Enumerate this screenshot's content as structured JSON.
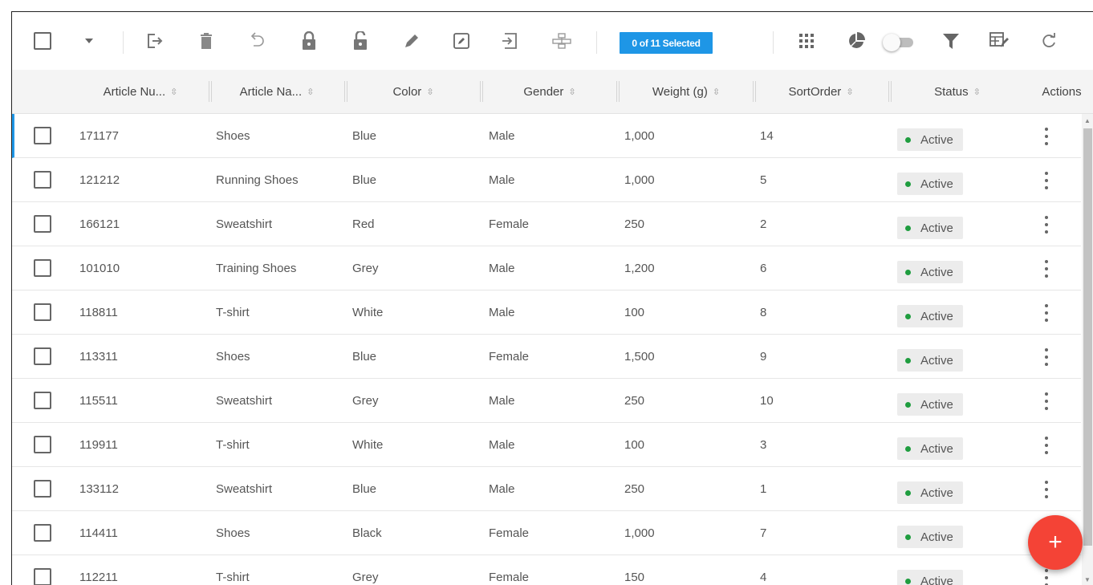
{
  "toolbar": {
    "selection_badge": "0 of 11 Selected",
    "icons": [
      "select-all-checkbox",
      "dropdown-arrow-icon",
      "export-icon",
      "delete-icon",
      "undo-icon",
      "lock-icon",
      "unlock-icon",
      "edit-icon",
      "edit-box-icon",
      "import-icon",
      "hierarchy-icon",
      "grid-icon",
      "pie-chart-icon",
      "toggle-switch",
      "filter-icon",
      "column-settings-icon",
      "refresh-icon"
    ],
    "accent_color": "#1e96e6"
  },
  "columns": [
    {
      "label": "Article Nu..."
    },
    {
      "label": "Article Na..."
    },
    {
      "label": "Color"
    },
    {
      "label": "Gender"
    },
    {
      "label": "Weight (g)"
    },
    {
      "label": "SortOrder"
    },
    {
      "label": "Status"
    },
    {
      "label": "Actions"
    }
  ],
  "sort_glyph": "⇳",
  "rows": [
    {
      "article_number": "171177",
      "article_name": "Shoes",
      "color": "Blue",
      "gender": "Male",
      "weight": "1,000",
      "sort_order": "14",
      "status": "Active"
    },
    {
      "article_number": "121212",
      "article_name": "Running Shoes",
      "color": "Blue",
      "gender": "Male",
      "weight": "1,000",
      "sort_order": "5",
      "status": "Active"
    },
    {
      "article_number": "166121",
      "article_name": "Sweatshirt",
      "color": "Red",
      "gender": "Female",
      "weight": "250",
      "sort_order": "2",
      "status": "Active"
    },
    {
      "article_number": "101010",
      "article_name": "Training Shoes",
      "color": "Grey",
      "gender": "Male",
      "weight": "1,200",
      "sort_order": "6",
      "status": "Active"
    },
    {
      "article_number": "118811",
      "article_name": "T-shirt",
      "color": "White",
      "gender": "Male",
      "weight": "100",
      "sort_order": "8",
      "status": "Active"
    },
    {
      "article_number": "113311",
      "article_name": "Shoes",
      "color": "Blue",
      "gender": "Female",
      "weight": "1,500",
      "sort_order": "9",
      "status": "Active"
    },
    {
      "article_number": "115511",
      "article_name": "Sweatshirt",
      "color": "Grey",
      "gender": "Male",
      "weight": "250",
      "sort_order": "10",
      "status": "Active"
    },
    {
      "article_number": "119911",
      "article_name": "T-shirt",
      "color": "White",
      "gender": "Male",
      "weight": "100",
      "sort_order": "3",
      "status": "Active"
    },
    {
      "article_number": "133112",
      "article_name": "Sweatshirt",
      "color": "Blue",
      "gender": "Male",
      "weight": "250",
      "sort_order": "1",
      "status": "Active"
    },
    {
      "article_number": "114411",
      "article_name": "Shoes",
      "color": "Black",
      "gender": "Female",
      "weight": "1,000",
      "sort_order": "7",
      "status": "Active"
    },
    {
      "article_number": "112211",
      "article_name": "T-shirt",
      "color": "Grey",
      "gender": "Female",
      "weight": "150",
      "sort_order": "4",
      "status": "Active"
    }
  ],
  "status_color": "#1f9d3f",
  "fab": {
    "label": "+",
    "color": "#f44336"
  }
}
